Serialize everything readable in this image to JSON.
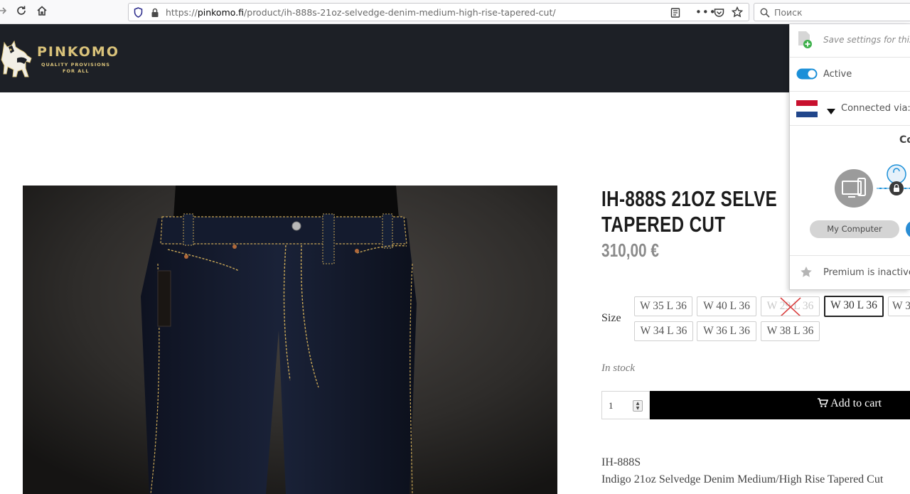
{
  "browser": {
    "url_prefix": "https://",
    "url_domain": "pinkomo.fi",
    "url_path": "/product/ih-888s-21oz-selvedge-denim-medium-high-rise-tapered-cut/",
    "search_placeholder": "Поиск"
  },
  "site": {
    "logo_name": "PINKOMO",
    "logo_tagline_1": "QUALITY PROVISIONS",
    "logo_tagline_2": "FOR ALL"
  },
  "product": {
    "title_line1": "IH-888S 21OZ SELVE",
    "title_line2": "TAPERED CUT",
    "price": "310,00 €",
    "size_label": "Size",
    "sizes": [
      {
        "label": "W 35 L 36",
        "state": "available"
      },
      {
        "label": "W 40 L 36",
        "state": "available"
      },
      {
        "label": "W 29 L 36",
        "state": "unavailable"
      },
      {
        "label": "W 30 L 36",
        "state": "selected"
      },
      {
        "label": "W 3",
        "state": "available"
      },
      {
        "label": "W 34 L 36",
        "state": "available"
      },
      {
        "label": "W 36 L 36",
        "state": "available"
      },
      {
        "label": "W 38 L 36",
        "state": "available"
      }
    ],
    "stock_status": "In stock",
    "quantity": "1",
    "add_to_cart_label": "Add to cart",
    "sku": "IH-888S",
    "description": "Indigo 21oz Selvedge Denim Medium/High Rise Tapered Cut"
  },
  "vpn_popup": {
    "save_settings": "Save settings for this",
    "active_label": "Active",
    "active": true,
    "connected_via": "Connected via:",
    "connected_heading": "Co",
    "my_computer": "My Computer",
    "premium_status": "Premium is inactive"
  },
  "colors": {
    "header_bg": "#1d2026",
    "logo_gold": "#d9c27a",
    "toggle_blue": "#1a8fd8",
    "add_to_cart_bg": "#000000"
  }
}
